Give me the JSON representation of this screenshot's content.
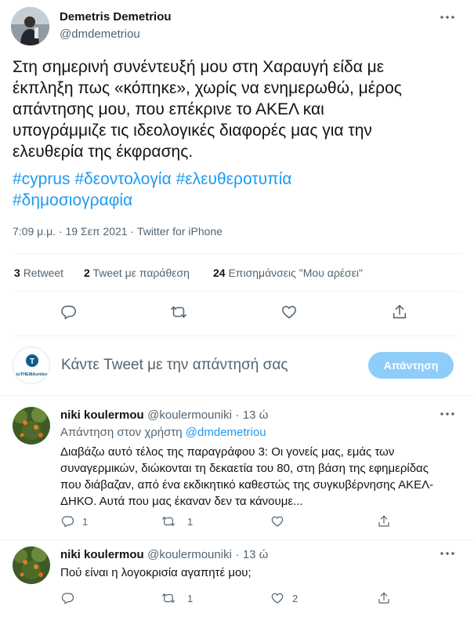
{
  "author": {
    "name": "Demetris Demetriou",
    "handle": "@dmdemetriou"
  },
  "tweet": {
    "text_lines": [
      "Στη σημερινή συνέντευξή μου στη Χαραυγή είδα με",
      "έκπληξη πως «κόπηκε», χωρίς να ενημερωθώ, μέρος",
      "απάντησης μου, που επέκρινε το ΑΚΕΛ και",
      "υπογράμμιζε τις ιδεολογικές διαφορές μας για την",
      "ελευθερία της έκφρασης."
    ],
    "hashtags": [
      "#cyprus",
      "#δεοντολογία",
      "#ελευθεροτυπία",
      "#δημοσιογραφία"
    ],
    "time": "7:09 μ.μ.",
    "date": "19 Σεπ 2021",
    "separator": "·",
    "source": "Twitter for iPhone"
  },
  "stats": {
    "retweets_count": "3",
    "retweets_label": "Retweet",
    "quotes_count": "2",
    "quotes_label": "Tweet με παράθεση",
    "likes_count": "24",
    "likes_label": "Επισημάνσεις \"Μου αρέσει\""
  },
  "compose": {
    "avatar_text": "toTHEMAonline",
    "placeholder": "Κάντε Tweet με την απάντησή σας",
    "button_label": "Απάντηση"
  },
  "replies": [
    {
      "name": "niki koulermou",
      "handle": "@koulermouniki",
      "time": "13 ώ",
      "replying_prefix": "Απάντηση στον χρήστη",
      "replying_to": "@dmdemetriou",
      "text_lines": [
        "Διαβάζω αυτό τέλος της παραγράφου 3: Οι γονείς μας, εμάς των",
        "συναγερμικών, διώκονται τη δεκαετία του 80, στη βάση της εφημερίδας",
        "που διάβαζαν, από ένα εκδικητικό καθεστώς της συγκυβέρνησης ΑΚΕΛ-",
        "ΔΗΚΟ. Αυτά που μας έκαναν δεν τα κάνουμε..."
      ],
      "reply_count": "1",
      "retweet_count": "1",
      "like_count": ""
    },
    {
      "name": "niki koulermou",
      "handle": "@koulermouniki",
      "time": "13 ώ",
      "text_lines": [
        "Πού είναι η λογοκρισία αγαπητέ μου;"
      ],
      "reply_count": "",
      "retweet_count": "1",
      "like_count": "2"
    }
  ],
  "icons": {
    "more": "more-horizontal-icon",
    "reply": "reply-bubble-icon",
    "retweet": "retweet-icon",
    "like": "heart-icon",
    "share": "share-upload-icon"
  },
  "colors": {
    "accent": "#1d9bf0",
    "secondary_text": "#536471",
    "divider": "#eff3f4",
    "reply_button": "#8ecdf8"
  }
}
